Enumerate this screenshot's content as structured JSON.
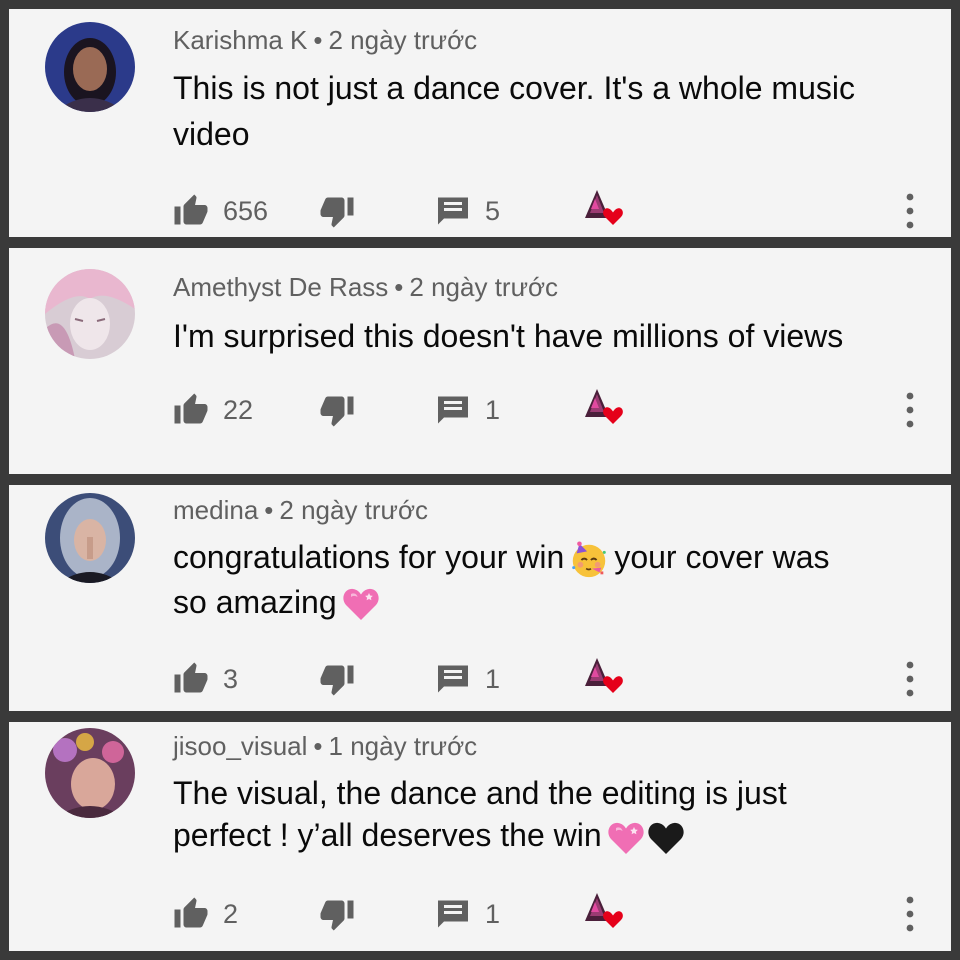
{
  "comments": [
    {
      "author": "Karishma K",
      "time": "2 ngày trước",
      "text_lines": [
        "This is not just a dance cover. It's a whole music",
        "video"
      ],
      "likes": "656",
      "replies": "5",
      "avatar_color": "#2b3a8a"
    },
    {
      "author": "Amethyst De Rass",
      "time": "2 ngày trước",
      "text_lines": [
        "I'm surprised this doesn't have millions of views"
      ],
      "likes": "22",
      "replies": "1",
      "avatar_color": "#c9b8c4"
    },
    {
      "author": "medina",
      "time": "2 ngày trước",
      "text_part1": "congratulations for your win",
      "text_part2": "your cover was",
      "text_part3": "so amazing",
      "likes": "3",
      "replies": "1",
      "avatar_color": "#4a5c85"
    },
    {
      "author": "jisoo_visual",
      "time": "1 ngày trước",
      "text_line1": "The visual, the dance and the editing is just",
      "text_line2": "perfect ! y’all deserves the win",
      "likes": "2",
      "replies": "1",
      "avatar_color": "#7a4a6a"
    }
  ],
  "separator": "•",
  "icons": {
    "like": "thumbs-up-icon",
    "dislike": "thumbs-down-icon",
    "reply": "comment-icon",
    "creator_heart": "creator-heart-icon",
    "more": "more-vertical-icon"
  },
  "colors": {
    "icon_gray": "#606060",
    "heart_red": "#e5001a",
    "card_bg": "#f4f4f4",
    "divider": "#3a3a3a"
  }
}
